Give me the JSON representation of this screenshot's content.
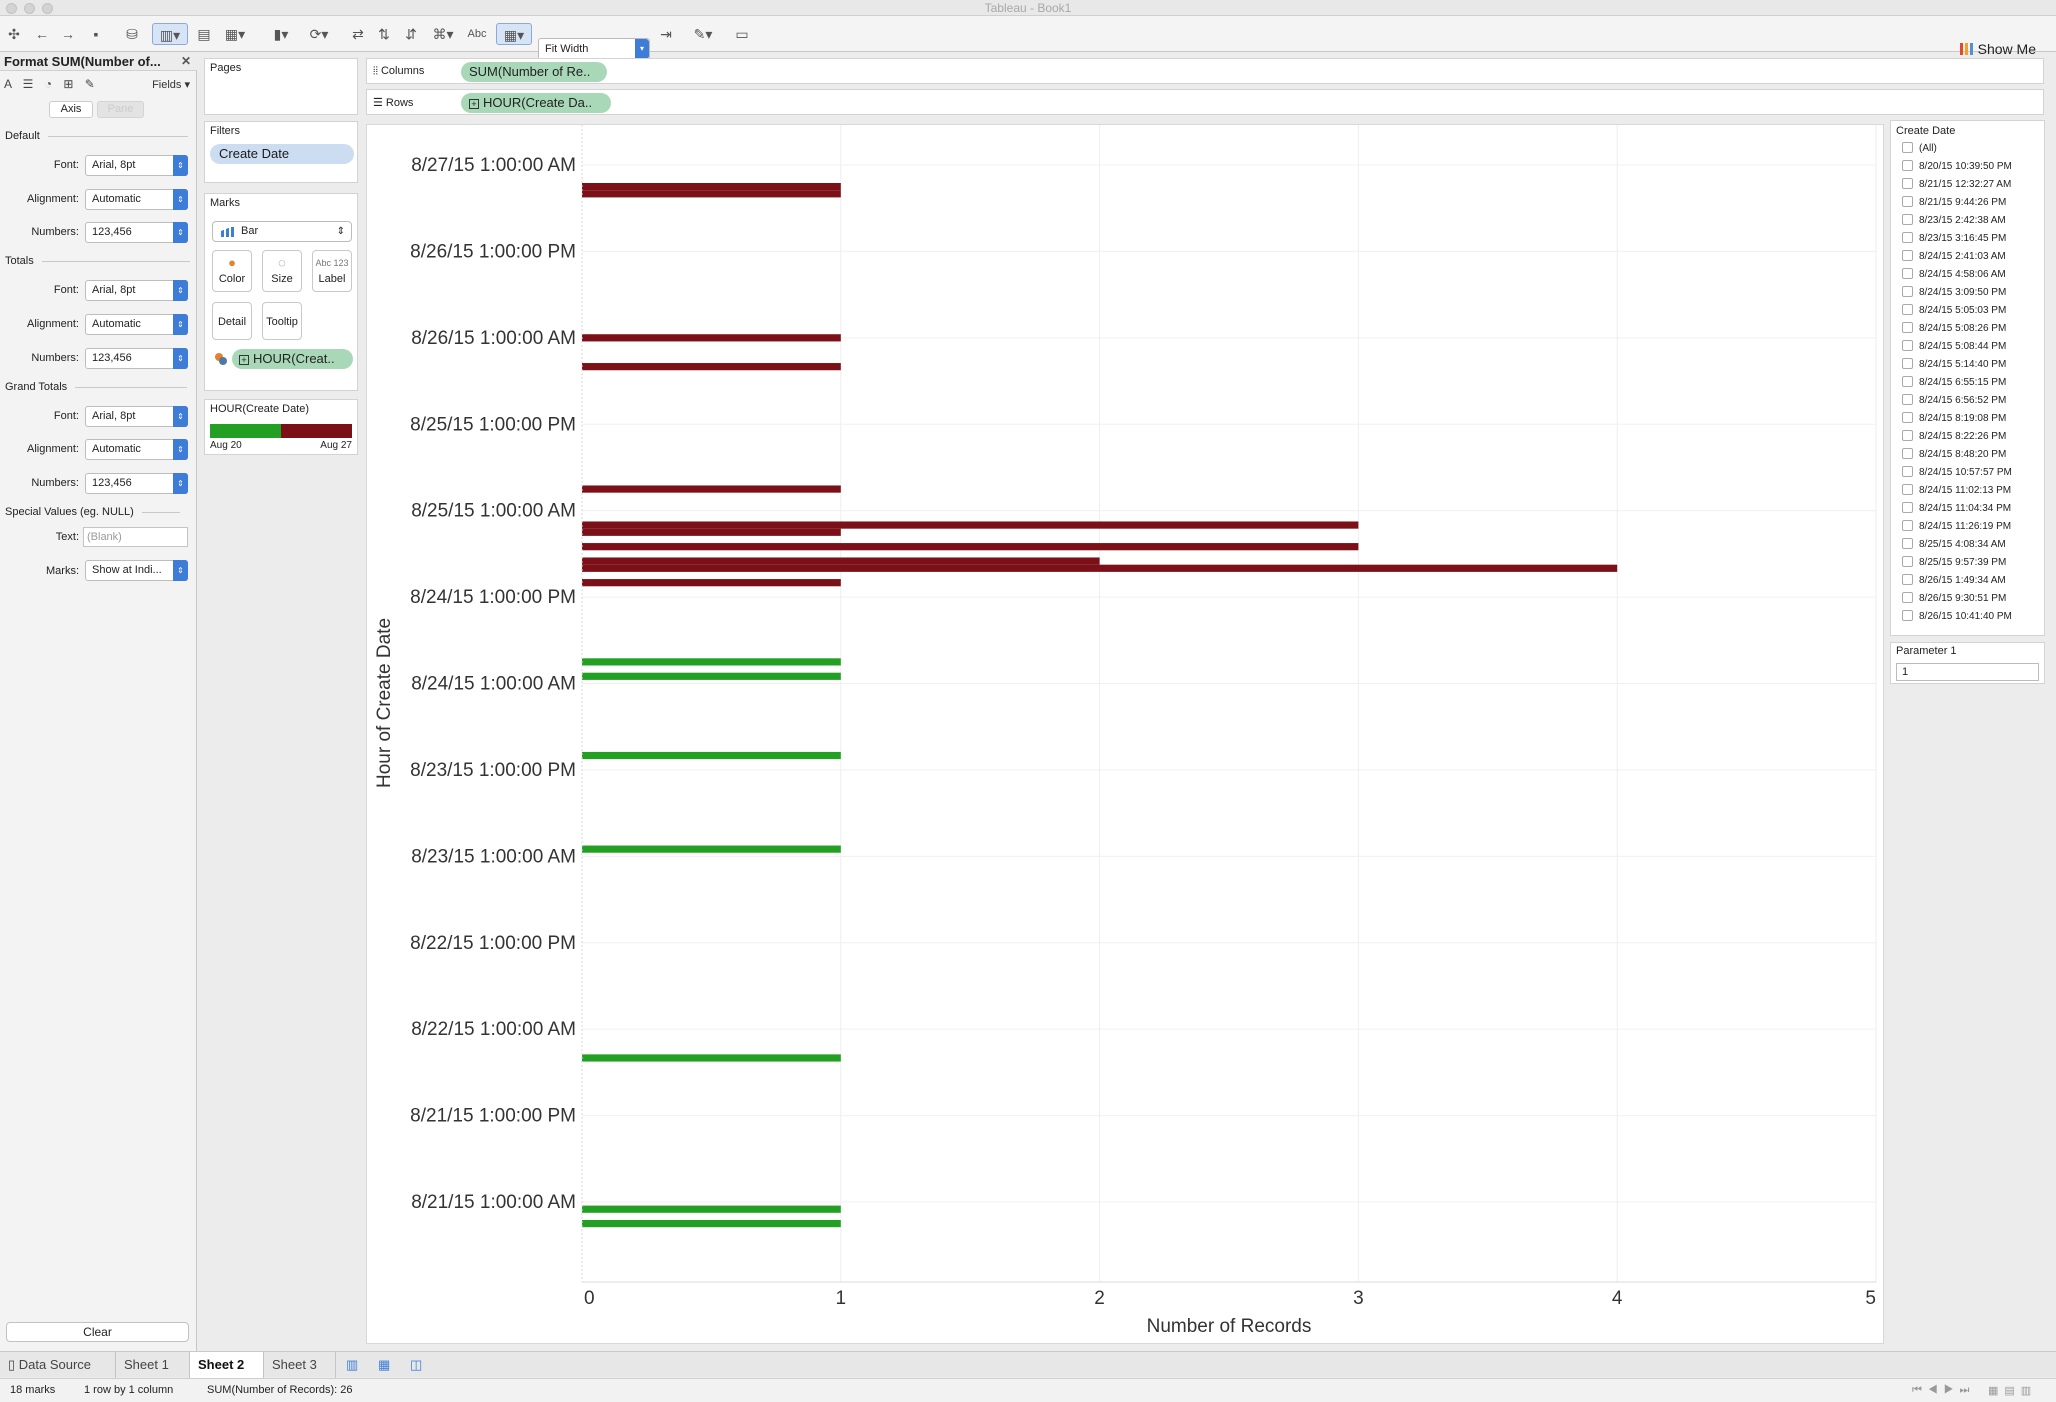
{
  "window": {
    "title": "Tableau - Book1"
  },
  "toolbar": {
    "fit": "Fit Width",
    "abc": "Abc",
    "show_me": "Show Me"
  },
  "format_pane": {
    "title": "Format SUM(Number of...",
    "fields_label": "Fields",
    "tabs": [
      "Axis",
      "Pane"
    ],
    "sections": {
      "default": "Default",
      "totals": "Totals",
      "grand_totals": "Grand Totals",
      "special": "Special Values (eg. NULL)"
    },
    "labels": {
      "font": "Font:",
      "alignment": "Alignment:",
      "numbers": "Numbers:",
      "text": "Text:",
      "marks": "Marks:"
    },
    "values": {
      "font": "Arial, 8pt",
      "alignment": "Automatic",
      "numbers": "123,456",
      "text_placeholder": "(Blank)",
      "marks": "Show at Indi..."
    },
    "clear_label": "Clear"
  },
  "cards": {
    "pages_title": "Pages",
    "filters_title": "Filters",
    "filter_pill": "Create Date",
    "marks_title": "Marks",
    "mark_type": "Bar",
    "mark_buttons": [
      "Color",
      "Size",
      "Label",
      "Detail",
      "Tooltip"
    ],
    "marks_pill": "HOUR(Creat..",
    "legend_title": "HOUR(Create Date)",
    "legend_low": "Aug 20",
    "legend_high": "Aug 27",
    "legend_colors": [
      "#23a023",
      "#7c1018"
    ]
  },
  "shelves": {
    "columns_label": "Columns",
    "columns_pill": "SUM(Number of Re..",
    "rows_label": "Rows",
    "rows_pill": "HOUR(Create Da.."
  },
  "filter_card": {
    "title": "Create Date",
    "items": [
      "(All)",
      "8/20/15 10:39:50 PM",
      "8/21/15 12:32:27 AM",
      "8/21/15 9:44:26 PM",
      "8/23/15 2:42:38 AM",
      "8/23/15 3:16:45 PM",
      "8/24/15 2:41:03 AM",
      "8/24/15 4:58:06 AM",
      "8/24/15 3:09:50 PM",
      "8/24/15 5:05:03 PM",
      "8/24/15 5:08:26 PM",
      "8/24/15 5:08:44 PM",
      "8/24/15 5:14:40 PM",
      "8/24/15 6:55:15 PM",
      "8/24/15 6:56:52 PM",
      "8/24/15 8:19:08 PM",
      "8/24/15 8:22:26 PM",
      "8/24/15 8:48:20 PM",
      "8/24/15 10:57:57 PM",
      "8/24/15 11:02:13 PM",
      "8/24/15 11:04:34 PM",
      "8/24/15 11:26:19 PM",
      "8/25/15 4:08:34 AM",
      "8/25/15 9:57:39 PM",
      "8/26/15 1:49:34 AM",
      "8/26/15 9:30:51 PM",
      "8/26/15 10:41:40 PM"
    ]
  },
  "parameter": {
    "title": "Parameter 1",
    "value": "1"
  },
  "sheet_tabs": [
    "Data Source",
    "Sheet 1",
    "Sheet 2",
    "Sheet 3"
  ],
  "active_tab": "Sheet 2",
  "status": {
    "marks": "18 marks",
    "dims": "1 row by 1 column",
    "sum": "SUM(Number of Records): 26"
  },
  "chart_data": {
    "type": "bar",
    "orientation": "horizontal",
    "xlabel": "Number of Records",
    "ylabel": "Hour of Create Date",
    "xlim": [
      0,
      5
    ],
    "xticks": [
      0,
      1,
      2,
      3,
      4,
      5
    ],
    "y_tick_labels": [
      "8/27/15 1:00:00 AM",
      "8/26/15 1:00:00 PM",
      "8/26/15 1:00:00 AM",
      "8/25/15 1:00:00 PM",
      "8/25/15 1:00:00 AM",
      "8/24/15 1:00:00 PM",
      "8/24/15 1:00:00 AM",
      "8/23/15 1:00:00 PM",
      "8/23/15 1:00:00 AM",
      "8/22/15 1:00:00 PM",
      "8/22/15 1:00:00 AM",
      "8/21/15 1:00:00 PM",
      "8/21/15 1:00:00 AM"
    ],
    "bars": [
      {
        "hour": "8/26/15 10:00 PM",
        "value": 1,
        "color": "#7c1018"
      },
      {
        "hour": "8/26/15 9:00 PM",
        "value": 1,
        "color": "#7c1018"
      },
      {
        "hour": "8/26/15 1:00 AM",
        "value": 1,
        "color": "#7c1018"
      },
      {
        "hour": "8/25/15 9:00 PM",
        "value": 1,
        "color": "#7c1018"
      },
      {
        "hour": "8/25/15 4:00 AM",
        "value": 1,
        "color": "#7c1018"
      },
      {
        "hour": "8/24/15 11:00 PM",
        "value": 3,
        "color": "#7c1018"
      },
      {
        "hour": "8/24/15 10:00 PM",
        "value": 1,
        "color": "#7c1018"
      },
      {
        "hour": "8/24/15 8:00 PM",
        "value": 3,
        "color": "#7c1018"
      },
      {
        "hour": "8/24/15 6:00 PM",
        "value": 2,
        "color": "#7c1018"
      },
      {
        "hour": "8/24/15 5:00 PM",
        "value": 4,
        "color": "#7c1018"
      },
      {
        "hour": "8/24/15 3:00 PM",
        "value": 1,
        "color": "#7c1018"
      },
      {
        "hour": "8/24/15 4:00 AM",
        "value": 1,
        "color": "#23a023"
      },
      {
        "hour": "8/24/15 2:00 AM",
        "value": 1,
        "color": "#23a023"
      },
      {
        "hour": "8/23/15 3:00 PM",
        "value": 1,
        "color": "#23a023"
      },
      {
        "hour": "8/23/15 2:00 AM",
        "value": 1,
        "color": "#23a023"
      },
      {
        "hour": "8/21/15 9:00 PM",
        "value": 1,
        "color": "#23a023"
      },
      {
        "hour": "8/21/15 12:00 AM",
        "value": 1,
        "color": "#23a023"
      },
      {
        "hour": "8/20/15 10:00 PM",
        "value": 1,
        "color": "#23a023"
      }
    ]
  }
}
